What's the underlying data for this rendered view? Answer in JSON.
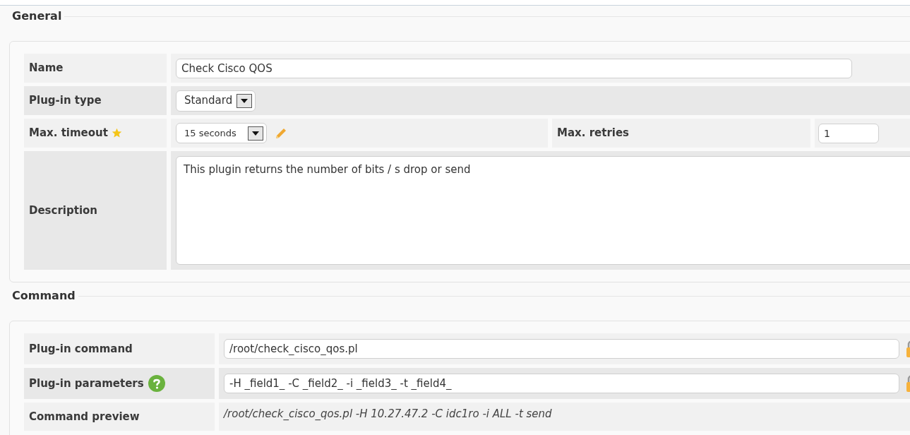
{
  "sections": [
    {
      "title": "General",
      "rows": [
        {
          "kind": "text",
          "label": "Name",
          "value": "Check Cisco QOS"
        },
        {
          "kind": "select",
          "label": "Plug-in type",
          "value": "Standard"
        },
        {
          "kind": "pair",
          "label": "Max. timeout",
          "starred": true,
          "value": "15 seconds",
          "editable": true,
          "label2": "Max. retries",
          "value2": "1"
        },
        {
          "kind": "textarea",
          "label": "Description",
          "value": "This plugin returns the number of bits / s drop or send"
        }
      ]
    },
    {
      "title": "Command",
      "rows": [
        {
          "kind": "text",
          "label": "Plug-in command",
          "value": "/root/check_cisco_qos.pl",
          "locked": true
        },
        {
          "kind": "text",
          "label": "Plug-in parameters",
          "help": true,
          "value": "-H _field1_ -C _field2_ -i _field3_ -t _field4_",
          "locked": true
        },
        {
          "kind": "preview",
          "label": "Command preview",
          "value": "/root/check_cisco_qos.pl -H 10.27.47.2 -C idc1ro -i ALL -t send"
        }
      ]
    }
  ]
}
